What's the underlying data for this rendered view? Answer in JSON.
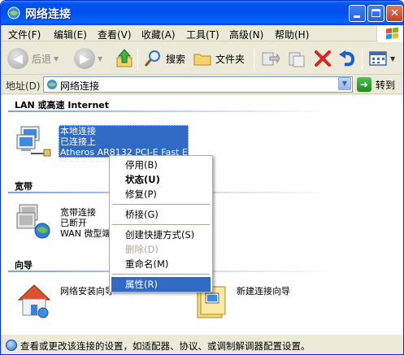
{
  "window": {
    "title": "网络连接"
  },
  "menubar": [
    "文件(F)",
    "编辑(E)",
    "查看(V)",
    "收藏(A)",
    "工具(T)",
    "高级(N)",
    "帮助(H)"
  ],
  "toolbar": {
    "back_label": "后退",
    "search_label": "搜索",
    "folders_label": "文件夹"
  },
  "address": {
    "label": "地址(D)",
    "value": "网络连接",
    "go_label": "转到"
  },
  "groups": {
    "lan": "LAN 或高速 Internet",
    "broadband": "宽带",
    "wizard": "向导"
  },
  "connections": {
    "lan": {
      "name": "本地连接",
      "status": "已连接上",
      "device": "Atheros AR8132 PCI-E Fast Et..."
    },
    "broadband": {
      "name": "宽带连接",
      "status": "已断开",
      "device": "WAN 微型端口"
    },
    "setup_wizard": {
      "name": "网络安装向导"
    },
    "new_wizard": {
      "name": "新建连接向导"
    }
  },
  "context_menu": [
    {
      "label": "停用(B)",
      "style": "normal"
    },
    {
      "label": "状态(U)",
      "style": "bold"
    },
    {
      "label": "修复(P)",
      "style": "normal"
    },
    {
      "label": "桥接(G)",
      "style": "normal"
    },
    {
      "label": "创建快捷方式(S)",
      "style": "normal"
    },
    {
      "label": "删除(D)",
      "style": "disabled"
    },
    {
      "label": "重命名(M)",
      "style": "normal"
    },
    {
      "label": "属性(R)",
      "style": "selected"
    }
  ],
  "status": {
    "text": "查看或更改该连接的设置，如适配器、协议、或调制解调器配置设置。"
  }
}
